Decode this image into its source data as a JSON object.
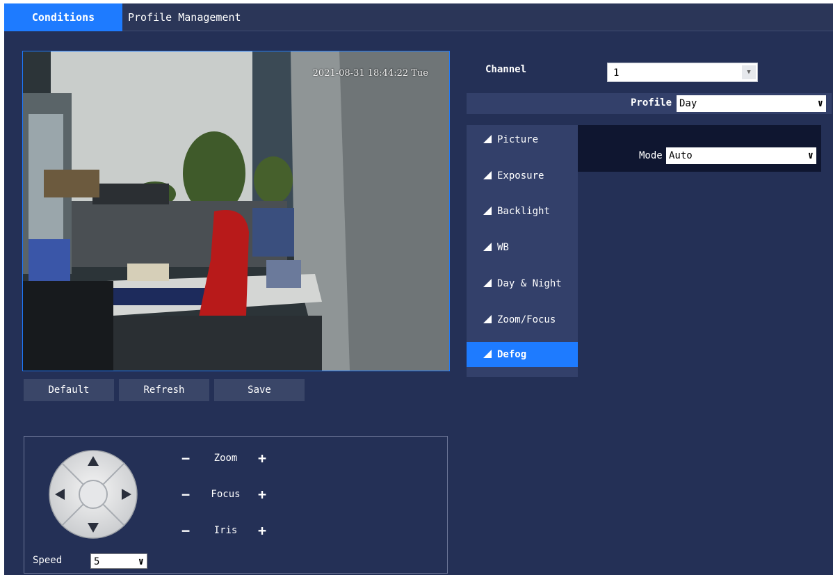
{
  "tabs": [
    {
      "label": "Conditions",
      "active": true
    },
    {
      "label": "Profile Management",
      "active": false
    }
  ],
  "video": {
    "timestamp": "2021-08-31 18:44:22 Tue"
  },
  "buttons": {
    "default": "Default",
    "refresh": "Refresh",
    "save": "Save"
  },
  "ptz": {
    "zoom_label": "Zoom",
    "focus_label": "Focus",
    "iris_label": "Iris",
    "minus": "−",
    "plus": "+",
    "speed_label": "Speed",
    "speed_value": "5"
  },
  "channel": {
    "label": "Channel",
    "value": "1"
  },
  "profile": {
    "label": "Profile",
    "value": "Day"
  },
  "menu": {
    "items": [
      {
        "label": "Picture"
      },
      {
        "label": "Exposure"
      },
      {
        "label": "Backlight"
      },
      {
        "label": "WB"
      },
      {
        "label": "Day & Night"
      },
      {
        "label": "Zoom/Focus"
      },
      {
        "label": "Defog",
        "active": true
      }
    ]
  },
  "defog": {
    "mode_label": "Mode",
    "mode_value": "Auto"
  },
  "colors": {
    "background": "#243056",
    "accent": "#1e7bff",
    "panel": "#33406a"
  },
  "icons": {
    "ptz_up": "triangle-up-icon",
    "ptz_down": "triangle-down-icon",
    "ptz_left": "triangle-left-icon",
    "ptz_right": "triangle-right-icon",
    "menu_bullet": "triangle-corner-icon",
    "dropdown": "chevron-down-icon"
  }
}
